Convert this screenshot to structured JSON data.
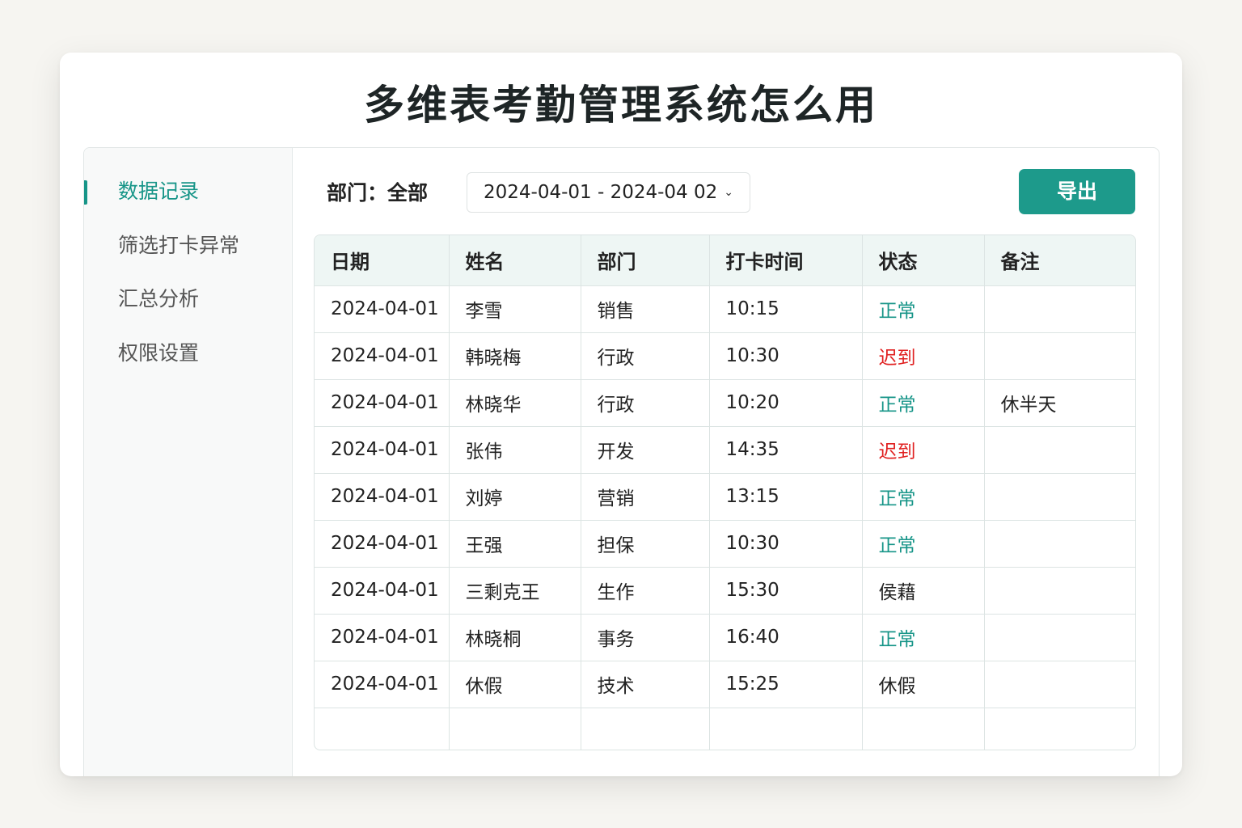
{
  "title": "多维表考勤管理系统怎么用",
  "sidebar": {
    "items": [
      {
        "label": "数据记录",
        "active": true
      },
      {
        "label": "筛选打卡异常",
        "active": false
      },
      {
        "label": "汇总分析",
        "active": false
      },
      {
        "label": "权限设置",
        "active": false
      }
    ]
  },
  "filters": {
    "department_label": "部门：全部",
    "date_range": "2024-04-01 - 2024-04 02"
  },
  "toolbar": {
    "export_label": "导出"
  },
  "colors": {
    "accent": "#179588",
    "late": "#e02020"
  },
  "table": {
    "headers": [
      "日期",
      "姓名",
      "部门",
      "打卡时间",
      "状态",
      "备注"
    ],
    "rows": [
      {
        "date": "2024-04-01",
        "name": "李雪",
        "dept": "销售",
        "time": "10:15",
        "status": "正常",
        "status_type": "normal",
        "note": ""
      },
      {
        "date": "2024-04-01",
        "name": "韩晓梅",
        "dept": "行政",
        "time": "10:30",
        "status": "迟到",
        "status_type": "late",
        "note": ""
      },
      {
        "date": "2024-04-01",
        "name": "林晓华",
        "dept": "行政",
        "time": "10:20",
        "status": "正常",
        "status_type": "normal",
        "note": "休半天"
      },
      {
        "date": "2024-04-01",
        "name": "张伟",
        "dept": "开发",
        "time": "14:35",
        "status": "迟到",
        "status_type": "late",
        "note": ""
      },
      {
        "date": "2024-04-01",
        "name": "刘婷",
        "dept": "营销",
        "time": "13:15",
        "status": "正常",
        "status_type": "normal",
        "note": ""
      },
      {
        "date": "2024-04-01",
        "name": "王强",
        "dept": "担保",
        "time": "10:30",
        "status": "正常",
        "status_type": "normal",
        "note": ""
      },
      {
        "date": "2024-04-01",
        "name": "三剩克王",
        "dept": "生作",
        "time": "15:30",
        "status": "侯藉",
        "status_type": "other",
        "note": ""
      },
      {
        "date": "2024-04-01",
        "name": "林晓桐",
        "dept": "事务",
        "time": "16:40",
        "status": "正常",
        "status_type": "normal",
        "note": ""
      },
      {
        "date": "2024-04-01",
        "name": "休假",
        "dept": "技术",
        "time": "15:25",
        "status": "休假",
        "status_type": "other",
        "note": ""
      }
    ]
  }
}
